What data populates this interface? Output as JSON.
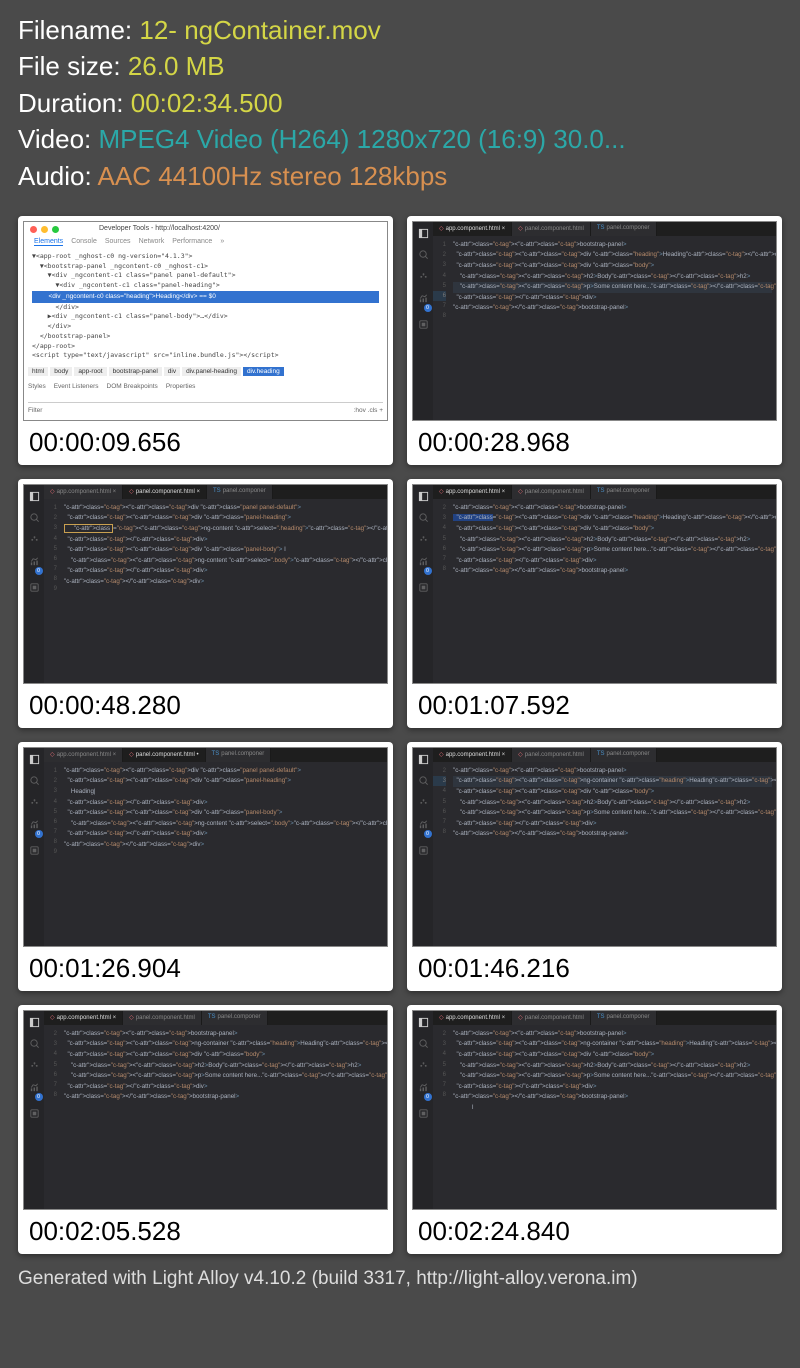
{
  "header": {
    "filename_label": "Filename: ",
    "filename": "12- ngContainer.mov",
    "size_label": "File size: ",
    "size": "26.0 MB",
    "duration_label": "Duration: ",
    "duration": "00:02:34.500",
    "video_label": "Video: ",
    "video": "MPEG4 Video (H264) 1280x720 (16:9) 30.0...",
    "audio_label": "Audio: ",
    "audio": "AAC 44100Hz stereo 128kbps"
  },
  "devtools": {
    "title": "Developer Tools - http://localhost:4200/",
    "tabs": [
      "Elements",
      "Console",
      "Sources",
      "Network",
      "Performance",
      "»"
    ],
    "breadcrumb": [
      "html",
      "body",
      "app-root",
      "bootstrap-panel",
      "div",
      "div.panel-heading",
      "div.heading"
    ],
    "sub": [
      "Styles",
      "Event Listeners",
      "DOM Breakpoints",
      "Properties"
    ],
    "filter": "Filter",
    "hov": ":hov",
    "cls": ".cls +",
    "code_lines": [
      "▼<app-root _nghost-c0 ng-version=\"4.1.3\">",
      "  ▼<bootstrap-panel _ngcontent-c0 _nghost-c1>",
      "    ▼<div _ngcontent-c1 class=\"panel panel-default\">",
      "      ▼<div _ngcontent-c1 class=\"panel-heading\">",
      "        <div _ngcontent-c0 class=\"heading\">Heading</div> == $0",
      "      </div>",
      "    ▶<div _ngcontent-c1 class=\"panel-body\">…</div>",
      "    </div>",
      "  </bootstrap-panel>",
      "</app-root>",
      "<script type=\"text/javascript\" src=\"inline.bundle.js\"></script>"
    ]
  },
  "vs_tabs": {
    "app": "app.component.html",
    "panel": "panel.component.html",
    "ts": "panel.componer"
  },
  "thumbs": [
    {
      "ts": "00:00:09.656",
      "kind": "dev"
    },
    {
      "ts": "00:00:28.968",
      "kind": "vs",
      "active": 0,
      "lines": [
        {
          "n": 1,
          "t": ""
        },
        {
          "n": 2,
          "t": "<bootstrap-panel>"
        },
        {
          "n": 3,
          "t": "  <div class=\"heading\">Heading</div>"
        },
        {
          "n": 4,
          "t": "  <div class=\"body\">"
        },
        {
          "n": 5,
          "t": "    <h2>Body</h2>"
        },
        {
          "n": 6,
          "t": "    <p>Some content here...</p>",
          "hl": true
        },
        {
          "n": 7,
          "t": "  </div>"
        },
        {
          "n": 8,
          "t": "</bootstrap-panel>"
        }
      ]
    },
    {
      "ts": "00:00:48.280",
      "kind": "vs",
      "active": 1,
      "lines": [
        {
          "n": 1,
          "t": ""
        },
        {
          "n": 2,
          "t": "<div class=\"panel panel-default\">"
        },
        {
          "n": 3,
          "t": "  <div class=\"panel-heading\">"
        },
        {
          "n": 4,
          "t": "    <ng-content select=\".heading\"></ng-content>",
          "box": true
        },
        {
          "n": 5,
          "t": "  </div>"
        },
        {
          "n": 6,
          "t": "  <div class=\"panel-body\"> I"
        },
        {
          "n": 7,
          "t": "    <ng-content select=\".body\"></ng-content>"
        },
        {
          "n": 8,
          "t": "  </div>"
        },
        {
          "n": 9,
          "t": "</div>"
        }
      ]
    },
    {
      "ts": "00:01:07.592",
      "kind": "vs",
      "active": 0,
      "lines": [
        {
          "n": 2,
          "t": "<bootstrap-panel>"
        },
        {
          "n": 3,
          "t": "  <div class=\"heading\">Heading</div>",
          "sel": true
        },
        {
          "n": 4,
          "t": "  <div class=\"body\">"
        },
        {
          "n": 5,
          "t": "    <h2>Body</h2>"
        },
        {
          "n": 6,
          "t": "    <p>Some content here...</p>"
        },
        {
          "n": 7,
          "t": "  </div>"
        },
        {
          "n": 8,
          "t": "</bootstrap-panel>"
        }
      ]
    },
    {
      "ts": "00:01:26.904",
      "kind": "vs",
      "active": 1,
      "dirty": true,
      "lines": [
        {
          "n": 1,
          "t": ""
        },
        {
          "n": 2,
          "t": "<div class=\"panel panel-default\">"
        },
        {
          "n": 3,
          "t": "  <div class=\"panel-heading\">"
        },
        {
          "n": 4,
          "t": "    Heading|"
        },
        {
          "n": 5,
          "t": "  </div>"
        },
        {
          "n": 6,
          "t": "  <div class=\"panel-body\">"
        },
        {
          "n": 7,
          "t": "    <ng-content select=\".body\"></ng-content>"
        },
        {
          "n": 8,
          "t": "  </div>"
        },
        {
          "n": 9,
          "t": "</div>"
        }
      ]
    },
    {
      "ts": "00:01:46.216",
      "kind": "vs",
      "active": 0,
      "lines": [
        {
          "n": 2,
          "t": "<bootstrap-panel>"
        },
        {
          "n": 3,
          "t": "  <ng-container class=\"heading\">Heading</ng-container>",
          "hl": true
        },
        {
          "n": 4,
          "t": "  <div class=\"body\">"
        },
        {
          "n": 5,
          "t": "    <h2>Body</h2>"
        },
        {
          "n": 6,
          "t": "    <p>Some content here...</p>"
        },
        {
          "n": 7,
          "t": "  </div>"
        },
        {
          "n": 8,
          "t": "</bootstrap-panel>"
        }
      ]
    },
    {
      "ts": "00:02:05.528",
      "kind": "vs",
      "active": 0,
      "lines": [
        {
          "n": 2,
          "t": "<bootstrap-panel>"
        },
        {
          "n": 3,
          "t": "  <ng-container class=\"heading\">Heading</ng-container>",
          "sel": "partial"
        },
        {
          "n": 4,
          "t": "  <div class=\"body\">"
        },
        {
          "n": 5,
          "t": "    <h2>Body</h2>"
        },
        {
          "n": 6,
          "t": "    <p>Some content here...</p>"
        },
        {
          "n": 7,
          "t": "  </div>"
        },
        {
          "n": 8,
          "t": "</bootstrap-panel>"
        }
      ]
    },
    {
      "ts": "00:02:24.840",
      "kind": "vs",
      "active": 0,
      "lines": [
        {
          "n": 2,
          "t": "<bootstrap-panel>"
        },
        {
          "n": 3,
          "t": "  <ng-container class=\"heading\">Heading</ng-container>"
        },
        {
          "n": 4,
          "t": "  <div class=\"body\">"
        },
        {
          "n": 5,
          "t": "    <h2>Body</h2>"
        },
        {
          "n": 6,
          "t": "    <p>Some content here...</p>"
        },
        {
          "n": 7,
          "t": "  </div>"
        },
        {
          "n": 8,
          "t": "</bootstrap-panel>"
        },
        {
          "n": "",
          "t": "           I"
        }
      ]
    }
  ],
  "footer": "Generated with Light Alloy v4.10.2 (build 3317, http://light-alloy.verona.im)"
}
